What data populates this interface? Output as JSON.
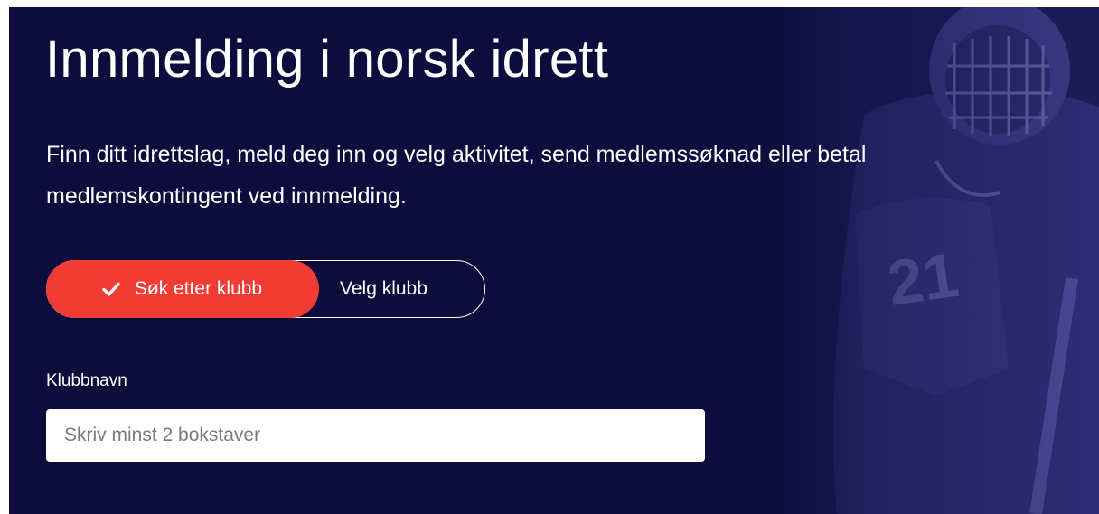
{
  "hero": {
    "title": "Innmelding i norsk idrett",
    "description": "Finn ditt idrettslag, meld deg inn og velg aktivitet, send medlemssøknad eller betal medlemskontingent ved innmelding.",
    "background_color": "#0d0c3c"
  },
  "mode_toggle": {
    "search_label": "Søk etter klubb",
    "select_label": "Velg klubb",
    "active": "search",
    "active_color": "#f13c33",
    "active_icon": "check-icon"
  },
  "club_field": {
    "label": "Klubbnavn",
    "value": "",
    "placeholder": "Skriv minst 2 bokstaver"
  }
}
